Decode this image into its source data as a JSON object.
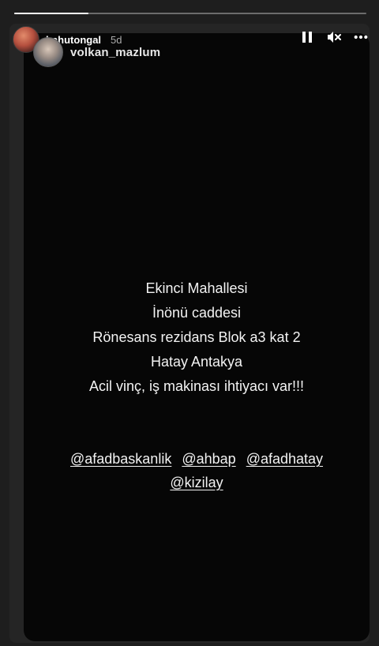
{
  "story": {
    "progress_fraction": 0.21,
    "author": {
      "username": "bahutongal",
      "time": "5d"
    },
    "repost": {
      "username": "volkan_mazlum"
    },
    "controls": {
      "pause_icon": "pause-icon",
      "mute_icon": "mute-icon",
      "more_icon": "more-options-icon"
    },
    "lines": [
      "Ekinci Mahallesi",
      "İnönü caddesi",
      "Rönesans rezidans Blok a3  kat 2",
      "Hatay Antakya",
      "Acil vinç, iş makinası ihtiyacı var!!!"
    ],
    "mentions": [
      "@afadbaskanlik",
      "@ahbap",
      "@afadhatay",
      "@kizilay"
    ],
    "colors": {
      "story_background": "#060606",
      "text": "#f3f3f3"
    }
  }
}
